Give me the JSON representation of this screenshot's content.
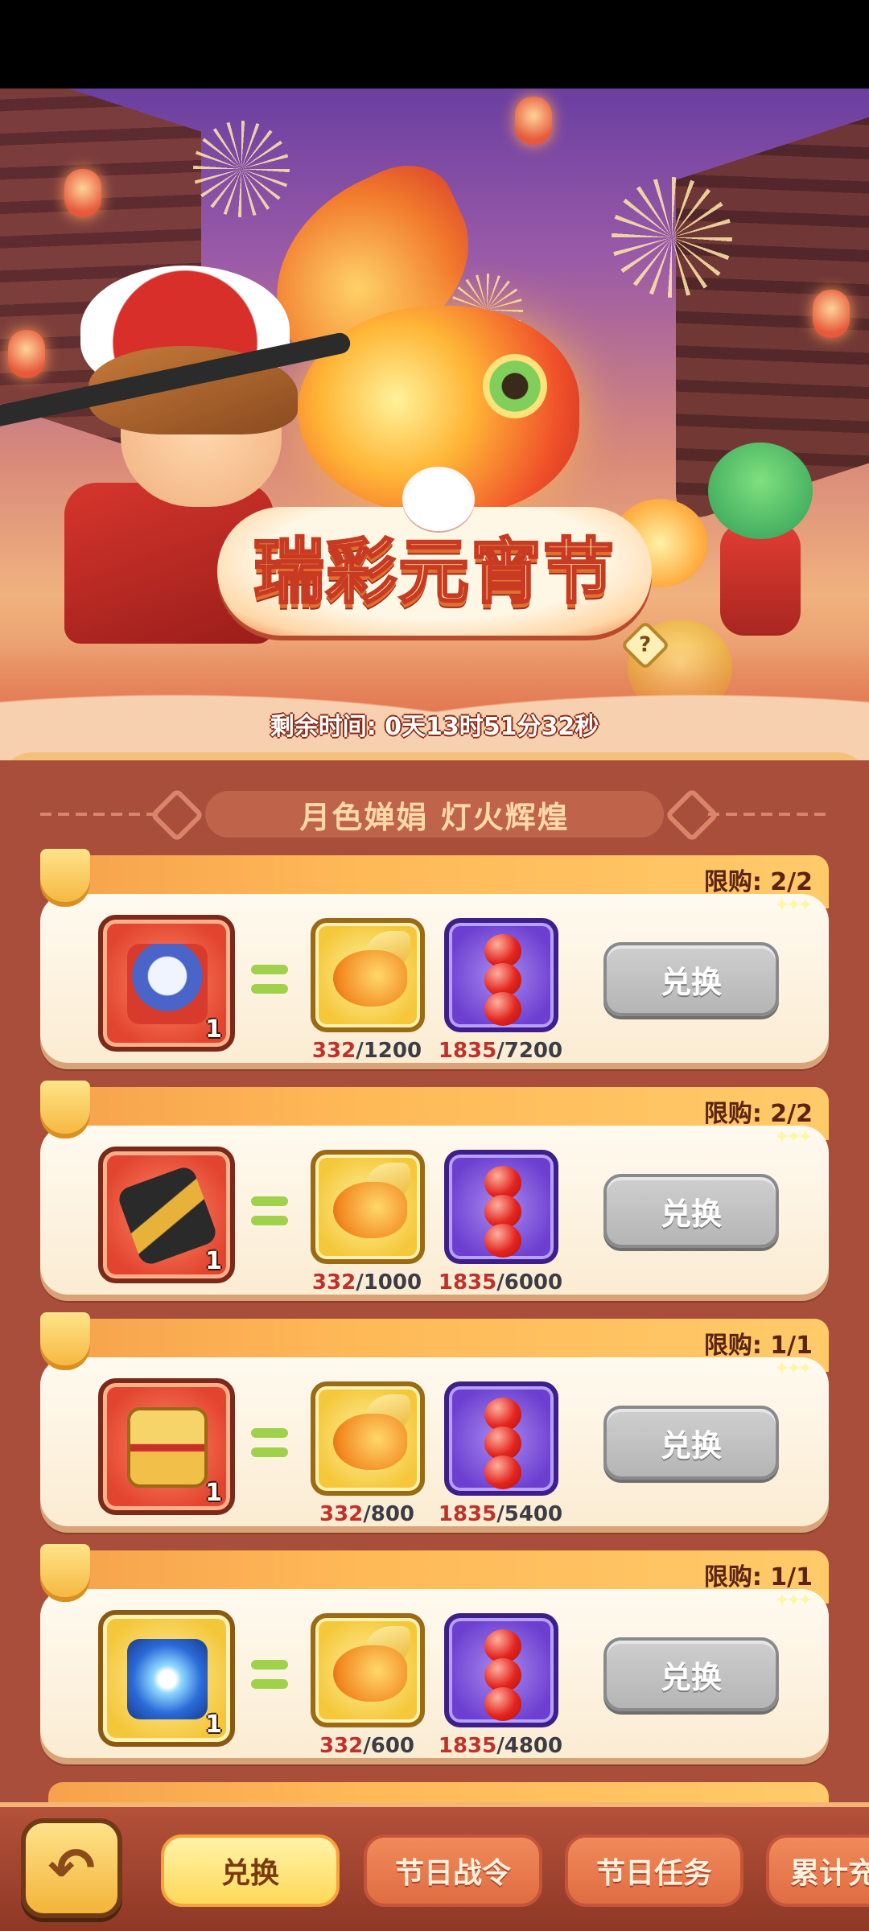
{
  "event": {
    "title": "瑞彩元宵节",
    "help_icon_label": "?",
    "time_left": "剩余时间: 0天13时51分32秒"
  },
  "section": {
    "title": "月色婵娟 灯火辉煌"
  },
  "currencies": {
    "fish": {
      "name": "fish-lantern-token",
      "have": "332"
    },
    "haw": {
      "name": "candied-haw-token",
      "have": "1835"
    }
  },
  "offers": [
    {
      "limit": "限购: 2/2",
      "reward_icon": "mecha-warrior-icon",
      "reward_count": "1",
      "fish_have": "332",
      "fish_need": "/1200",
      "haw_have": "1835",
      "haw_need": "/7200",
      "button": "兑换"
    },
    {
      "limit": "限购: 2/2",
      "reward_icon": "cannon-weapon-icon",
      "reward_count": "1",
      "fish_have": "332",
      "fish_need": "/1000",
      "haw_have": "1835",
      "haw_need": "/6000",
      "button": "兑换"
    },
    {
      "limit": "限购: 1/1",
      "reward_icon": "mystery-chest-icon",
      "reward_count": "1",
      "fish_have": "332",
      "fish_need": "/800",
      "haw_have": "1835",
      "haw_need": "/5400",
      "button": "兑换"
    },
    {
      "limit": "限购: 1/1",
      "reward_icon": "lightning-card-icon",
      "reward_count": "1",
      "fish_have": "332",
      "fish_need": "/600",
      "haw_have": "1835",
      "haw_need": "/4800",
      "button": "兑换"
    }
  ],
  "bottom_nav": {
    "back_icon": "back-arrow-icon",
    "tabs": [
      "兑换",
      "节日战令",
      "节日任务",
      "累计充"
    ]
  },
  "colors": {
    "panel": "#a84e3b",
    "accent_gold": "#ffca6a",
    "have_red": "#c0312a",
    "button_gray": "#b5b5b5"
  }
}
